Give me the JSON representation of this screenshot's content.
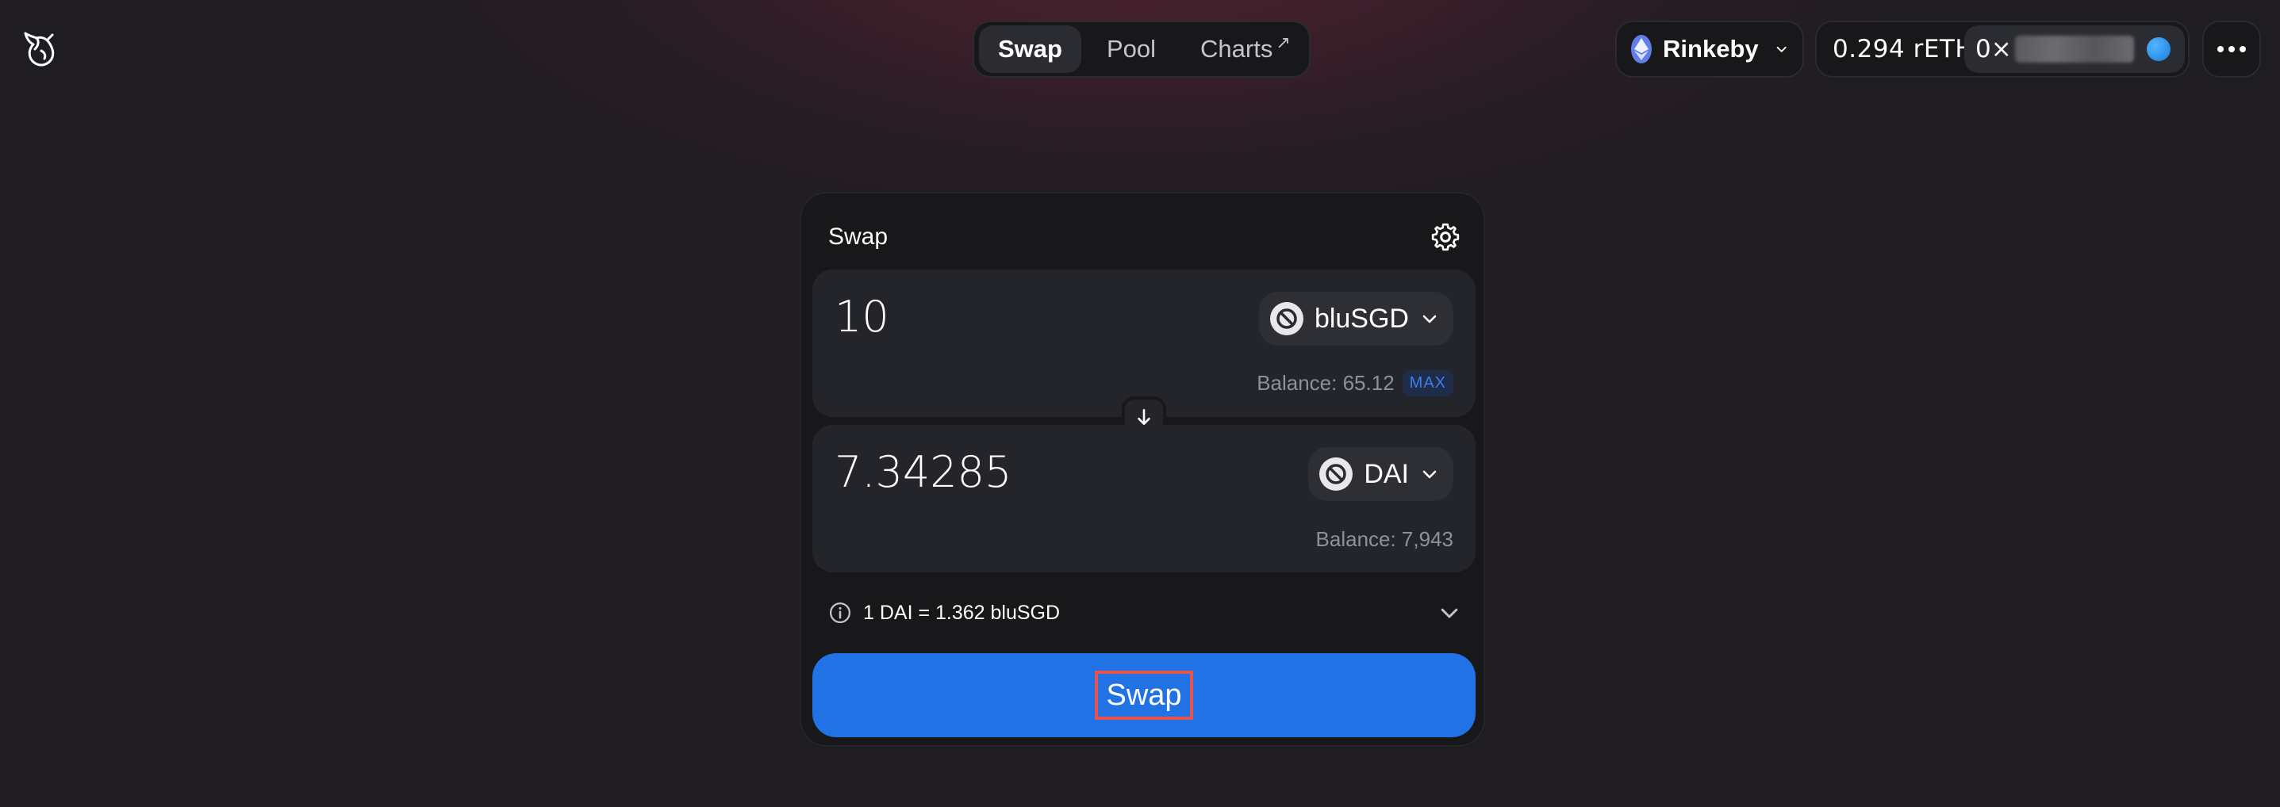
{
  "nav": {
    "tabs": [
      {
        "label": "Swap"
      },
      {
        "label": "Pool"
      },
      {
        "label": "Charts"
      }
    ],
    "charts_external_icon": "arrow-up-right-icon"
  },
  "header": {
    "network": "Rinkeby",
    "balance": "0.294 rETH",
    "address_prefix": "0×"
  },
  "card": {
    "title": "Swap",
    "input": {
      "amount": "10",
      "token": "bluSGD",
      "balance": "Balance: 65.12",
      "max_label": "MAX"
    },
    "output": {
      "amount": "7.34285",
      "token": "DAI",
      "balance": "Balance: 7,943"
    },
    "rate": "1 DAI = 1.362 bluSGD",
    "swap_button": "Swap"
  },
  "colors": {
    "accent": "#2172e5",
    "background": "#1f1d22",
    "card": "#18181b",
    "panel": "#24252a",
    "highlight_box": "#e8534f"
  }
}
